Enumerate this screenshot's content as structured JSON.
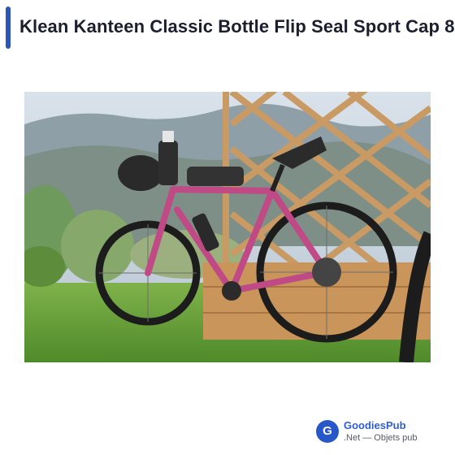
{
  "article": {
    "title": "Klean Kanteen Classic Bottle Flip Seal Sport Cap 8"
  },
  "photo": {
    "subject": "bicycle-photo"
  },
  "brand": {
    "logo_letter": "G",
    "name": "GoodiesPub",
    "tagline": ".Net — Objets pub",
    "color": "#2757c9"
  },
  "colors": {
    "accent": "#2c55b8",
    "title": "#1a1e2e"
  }
}
